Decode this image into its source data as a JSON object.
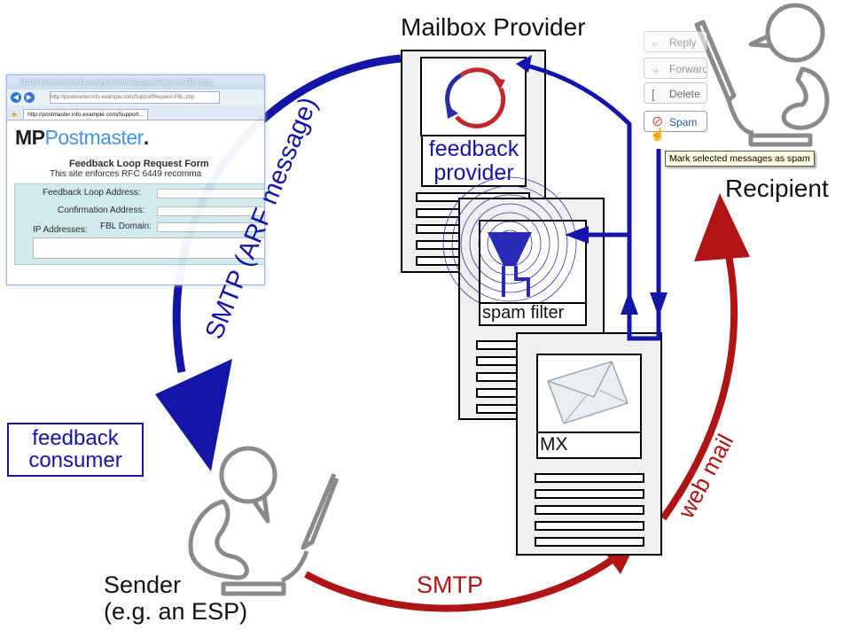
{
  "labels": {
    "mailbox_provider": "Mailbox Provider",
    "recipient": "Recipient",
    "sender_line1": "Sender",
    "sender_line2": "(e.g. an ESP)",
    "feedback_consumer_line1": "feedback",
    "feedback_consumer_line2": "consumer",
    "feedback_provider_line1": "feedback",
    "feedback_provider_line2": "provider",
    "spam_filter": "spam filter",
    "mx": "MX",
    "smtp_arf": "SMTP (ARF message)",
    "smtp": "SMTP",
    "web_mail": "web mail"
  },
  "browser": {
    "window_title": "http://postmaster.info.example.com/SupportRequest.FBL.php",
    "url": "http://postmaster.info.example.com/SupportRequest.FBL.php",
    "tab": "http://postmaster.info.example.com/Support...",
    "logo_mp": "MP",
    "logo_postmaster": "Postmaster",
    "logo_dot": ".",
    "form_heading": "Feedback Loop Request Form",
    "form_subtitle": "This site enforces RFC 6449 recomma",
    "fields": {
      "feedback_loop_address": "Feedback Loop Address:",
      "confirmation_address": "Confirmation Address:",
      "fbl_domain": "FBL Domain:",
      "ip_addresses": "IP Addresses:"
    }
  },
  "mail_client": {
    "reply": "Reply",
    "forward": "Forward",
    "delete": "Delete",
    "spam": "Spam",
    "tooltip": "Mark selected messages as spam"
  },
  "colors": {
    "blue": "#1414a8",
    "red": "#b01414",
    "gray": "#8a8a8a"
  }
}
